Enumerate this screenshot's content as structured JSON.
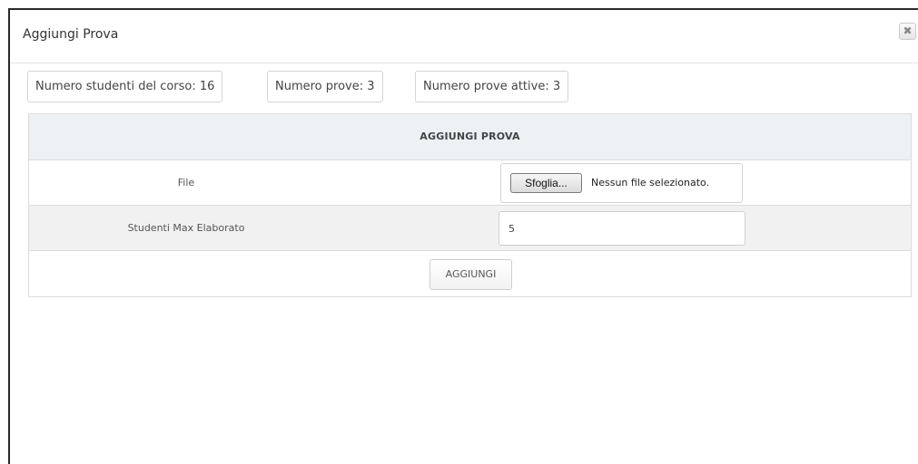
{
  "dialog": {
    "title": "Aggiungi Prova",
    "close_symbol": "✖"
  },
  "stats": {
    "students": "Numero studenti del corso: 16",
    "tests": "Numero prove: 3",
    "active_tests": "Numero prove attive: 3"
  },
  "form": {
    "header": "AGGIUNGI PROVA",
    "file_label": "File",
    "browse_label": "Sfoglia...",
    "file_status": "Nessun file selezionato.",
    "max_students_label": "Studenti Max Elaborato",
    "max_students_value": "5",
    "submit_label": "AGGIUNGI"
  }
}
